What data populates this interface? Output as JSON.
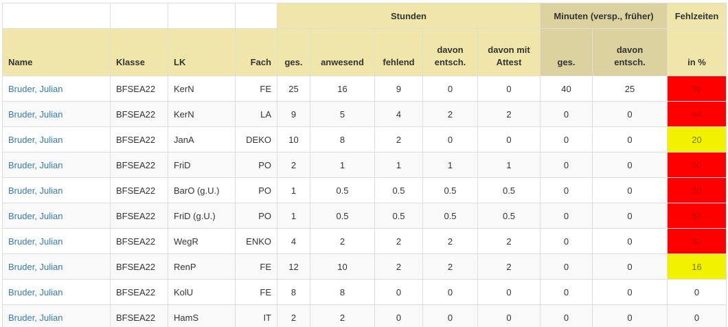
{
  "header": {
    "group_stunden": "Stunden",
    "group_minuten": "Minuten (versp., früher)",
    "group_fehlzeiten": "Fehlzeiten",
    "col_name": "Name",
    "col_klasse": "Klasse",
    "col_lk": "LK",
    "col_fach": "Fach",
    "col_std_ges": "ges.",
    "col_anwesend": "anwesend",
    "col_fehlend": "fehlend",
    "col_davon_entsch": "davon entsch.",
    "col_davon_attest": "davon mit Attest",
    "col_min_ges": "ges.",
    "col_min_entsch": "davon entsch.",
    "col_in_prozent": "in %"
  },
  "colors": {
    "header_bg": "#f0e6aa",
    "header_minuten_bg": "#dcd2a0",
    "link": "#337ab7",
    "pct_red": "#ff0000",
    "pct_yellow": "#f2f200"
  },
  "rows": [
    {
      "name": "Bruder, Julian",
      "klasse": "BFSEA22",
      "lk": "KerN",
      "fach": "FE",
      "ges": "25",
      "anwesend": "16",
      "fehlend": "9",
      "entsch": "0",
      "attest": "0",
      "min_ges": "40",
      "min_entsch": "25",
      "pct": "39",
      "pct_level": "red"
    },
    {
      "name": "Bruder, Julian",
      "klasse": "BFSEA22",
      "lk": "KerN",
      "fach": "LA",
      "ges": "9",
      "anwesend": "5",
      "fehlend": "4",
      "entsch": "2",
      "attest": "2",
      "min_ges": "0",
      "min_entsch": "0",
      "pct": "44",
      "pct_level": "red"
    },
    {
      "name": "Bruder, Julian",
      "klasse": "BFSEA22",
      "lk": "JanA",
      "fach": "DEKO",
      "ges": "10",
      "anwesend": "8",
      "fehlend": "2",
      "entsch": "0",
      "attest": "0",
      "min_ges": "0",
      "min_entsch": "0",
      "pct": "20",
      "pct_level": "yellow"
    },
    {
      "name": "Bruder, Julian",
      "klasse": "BFSEA22",
      "lk": "FriD",
      "fach": "PO",
      "ges": "2",
      "anwesend": "1",
      "fehlend": "1",
      "entsch": "1",
      "attest": "1",
      "min_ges": "0",
      "min_entsch": "0",
      "pct": "50",
      "pct_level": "red"
    },
    {
      "name": "Bruder, Julian",
      "klasse": "BFSEA22",
      "lk": "BarO (g.U.)",
      "fach": "PO",
      "ges": "1",
      "anwesend": "0.5",
      "fehlend": "0.5",
      "entsch": "0.5",
      "attest": "0.5",
      "min_ges": "0",
      "min_entsch": "0",
      "pct": "50",
      "pct_level": "red"
    },
    {
      "name": "Bruder, Julian",
      "klasse": "BFSEA22",
      "lk": "FriD (g.U.)",
      "fach": "PO",
      "ges": "1",
      "anwesend": "0.5",
      "fehlend": "0.5",
      "entsch": "0.5",
      "attest": "0.5",
      "min_ges": "0",
      "min_entsch": "0",
      "pct": "50",
      "pct_level": "red"
    },
    {
      "name": "Bruder, Julian",
      "klasse": "BFSEA22",
      "lk": "WegR",
      "fach": "ENKO",
      "ges": "4",
      "anwesend": "2",
      "fehlend": "2",
      "entsch": "2",
      "attest": "2",
      "min_ges": "0",
      "min_entsch": "0",
      "pct": "50",
      "pct_level": "red"
    },
    {
      "name": "Bruder, Julian",
      "klasse": "BFSEA22",
      "lk": "RenP",
      "fach": "FE",
      "ges": "12",
      "anwesend": "10",
      "fehlend": "2",
      "entsch": "2",
      "attest": "2",
      "min_ges": "0",
      "min_entsch": "0",
      "pct": "16",
      "pct_level": "yellow"
    },
    {
      "name": "Bruder, Julian",
      "klasse": "BFSEA22",
      "lk": "KolU",
      "fach": "FE",
      "ges": "8",
      "anwesend": "8",
      "fehlend": "0",
      "entsch": "0",
      "attest": "0",
      "min_ges": "0",
      "min_entsch": "0",
      "pct": "0",
      "pct_level": "none"
    },
    {
      "name": "Bruder, Julian",
      "klasse": "BFSEA22",
      "lk": "HamS",
      "fach": "IT",
      "ges": "2",
      "anwesend": "2",
      "fehlend": "0",
      "entsch": "0",
      "attest": "0",
      "min_ges": "0",
      "min_entsch": "0",
      "pct": "0",
      "pct_level": "none"
    }
  ]
}
